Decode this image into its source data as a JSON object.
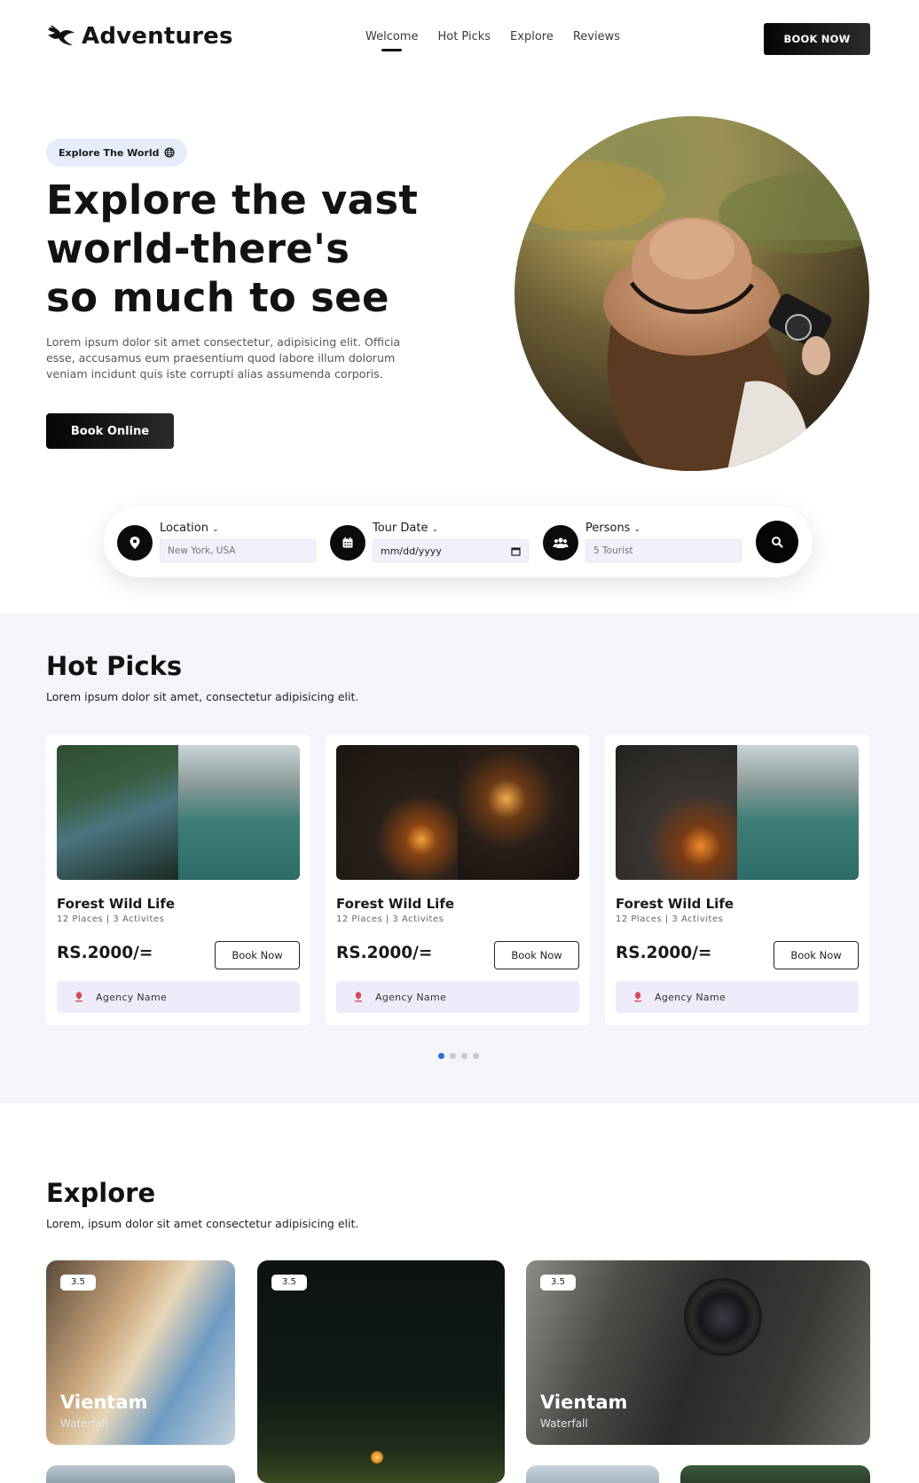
{
  "header": {
    "brand": "Adventures",
    "nav": [
      "Welcome",
      "Hot Picks",
      "Explore",
      "Reviews"
    ],
    "active_nav": "Welcome",
    "cta": "BOOK NOW"
  },
  "hero": {
    "badge": "Explore The World",
    "title_lines": [
      "Explore the vast",
      "world-there's",
      "so much to see"
    ],
    "description": "Lorem ipsum dolor sit amet consectetur, adipisicing elit. Officia esse, accusamus eum praesentium quod labore illum dolorum veniam incidunt quis iste corrupti alias assumenda corporis.",
    "button": "Book Online"
  },
  "search": {
    "location": {
      "label": "Location",
      "value": "New York, USA",
      "icon": "map-pin-icon"
    },
    "date": {
      "label": "Tour Date",
      "value": "mm/dd/yyyy",
      "icon": "calendar-icon"
    },
    "persons": {
      "label": "Persons",
      "value": "5 Tourist",
      "icon": "users-icon"
    },
    "search_icon": "search-icon"
  },
  "hotpicks": {
    "title": "Hot Picks",
    "subtitle": "Lorem ipsum dolor sit amet, consectetur adipisicing elit.",
    "cards": [
      {
        "title": "Forest Wild Life",
        "meta": "12 Places | 3 Activites",
        "price": "RS.2000/=",
        "button": "Book Now",
        "agency": "Agency Name"
      },
      {
        "title": "Forest Wild Life",
        "meta": "12 Places | 3 Activites",
        "price": "RS.2000/=",
        "button": "Book Now",
        "agency": "Agency Name"
      },
      {
        "title": "Forest Wild Life",
        "meta": "12 Places | 3 Activites",
        "price": "RS.2000/=",
        "button": "Book Now",
        "agency": "Agency Name"
      }
    ],
    "slider_pages": 4,
    "slider_active": 1
  },
  "explore": {
    "title": "Explore",
    "subtitle": "Lorem, ipsum dolor sit amet consectetur adipisicing elit.",
    "cards": [
      {
        "rating": "3.5",
        "title": "Vientam",
        "subtitle": "Waterfall"
      },
      {
        "rating": "3.5",
        "title": "",
        "subtitle": ""
      },
      {
        "rating": "3.5",
        "title": "Vientam",
        "subtitle": "Waterfall"
      }
    ]
  },
  "colors": {
    "primary": "#0b0b0b",
    "badge_bg": "#e7ecfb",
    "section_bg": "#f4f5fb",
    "agency_bg": "#eeebfb",
    "dot_active": "#2a6fdb"
  }
}
